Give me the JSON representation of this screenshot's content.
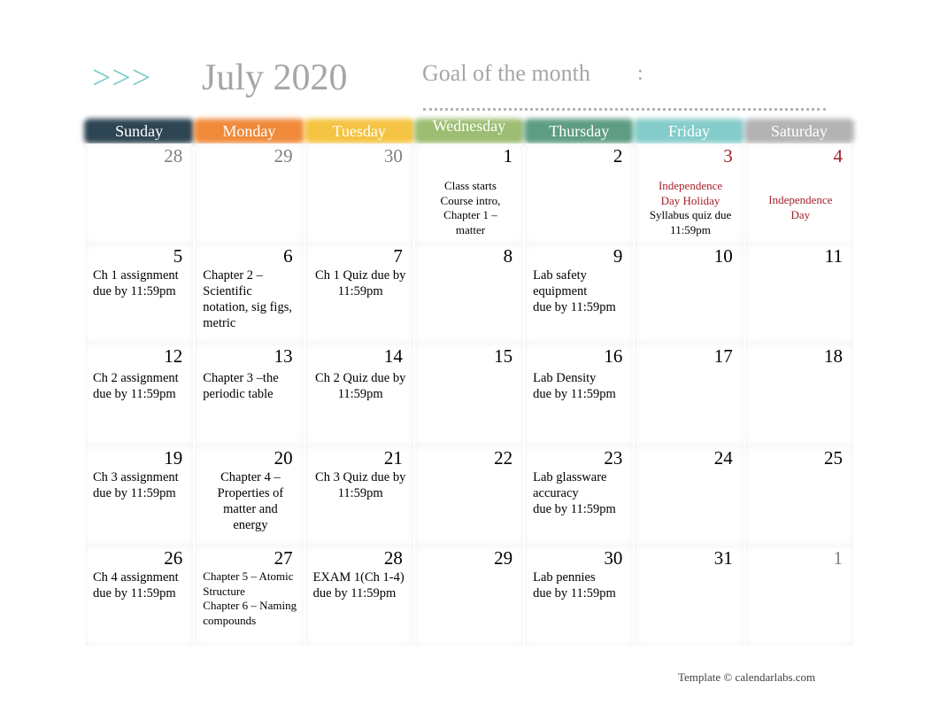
{
  "header": {
    "arrows": ">>>",
    "month_title": "July 2020",
    "goal_label": "Goal of the month",
    "goal_colon": ":",
    "goal_value": ""
  },
  "weekdays": [
    {
      "label": "Sunday",
      "color": "#2e4553"
    },
    {
      "label": "Monday",
      "color": "#f08a3a"
    },
    {
      "label": "Tuesday",
      "color": "#f5c342"
    },
    {
      "label": "Wednesday",
      "color": "#9cbd72"
    },
    {
      "label": "Thursday",
      "color": "#5e9d84"
    },
    {
      "label": "Friday",
      "color": "#84cccb"
    },
    {
      "label": "Saturday",
      "color": "#b3b3b3"
    }
  ],
  "colors": {
    "holiday_red": "#a31f2b",
    "title_gray": "#a6a6a6",
    "arrow_teal": "#7fcbc9"
  },
  "weeks": [
    [
      {
        "day": "28",
        "muted": true,
        "note": ""
      },
      {
        "day": "29",
        "muted": true,
        "note": ""
      },
      {
        "day": "30",
        "muted": true,
        "note": ""
      },
      {
        "day": "1",
        "note": "Class starts\nCourse intro,\nChapter 1 –\nmatter"
      },
      {
        "day": "2",
        "note": ""
      },
      {
        "day": "3",
        "holiday": true,
        "holiday_note": "Independence\nDay Holiday",
        "note": "Syllabus quiz due\n11:59pm"
      },
      {
        "day": "4",
        "holiday": true,
        "holiday_note": "Independence\nDay",
        "note": ""
      }
    ],
    [
      {
        "day": "5",
        "note": "Ch 1 assignment\ndue by 11:59pm"
      },
      {
        "day": "6",
        "note": "Chapter 2 –\nScientific\nnotation, sig figs,\nmetric"
      },
      {
        "day": "7",
        "note": "Ch 1 Quiz due by\n11:59pm"
      },
      {
        "day": "8",
        "note": ""
      },
      {
        "day": "9",
        "note": "Lab safety\nequipment\n  due by 11:59pm"
      },
      {
        "day": "10",
        "note": ""
      },
      {
        "day": "11",
        "note": ""
      }
    ],
    [
      {
        "day": "12",
        "note": "Ch 2 assignment\ndue by 11:59pm"
      },
      {
        "day": "13",
        "note": "Chapter 3 –the\nperiodic table"
      },
      {
        "day": "14",
        "note": "Ch 2 Quiz due by\n11:59pm"
      },
      {
        "day": "15",
        "note": ""
      },
      {
        "day": "16",
        "note": "Lab Density\n  due by 11:59pm"
      },
      {
        "day": "17",
        "note": ""
      },
      {
        "day": "18",
        "note": ""
      }
    ],
    [
      {
        "day": "19",
        "note": "Ch 3 assignment\ndue by 11:59pm"
      },
      {
        "day": "20",
        "note": "Chapter 4 –\nProperties of\nmatter and\nenergy"
      },
      {
        "day": "21",
        "note": "Ch 3 Quiz due by\n11:59pm"
      },
      {
        "day": "22",
        "note": ""
      },
      {
        "day": "23",
        "note": "Lab glassware\naccuracy\n  due by 11:59pm"
      },
      {
        "day": "24",
        "note": ""
      },
      {
        "day": "25",
        "note": ""
      }
    ],
    [
      {
        "day": "26",
        "note": "Ch 4 assignment\ndue by 11:59pm"
      },
      {
        "day": "27",
        "note": "Chapter 5 – Atomic\nStructure\nChapter 6 – Naming\ncompounds"
      },
      {
        "day": "28",
        "note": " EXAM 1(Ch 1-4)\ndue by 11:59pm"
      },
      {
        "day": "29",
        "note": ""
      },
      {
        "day": "30",
        "note": "Lab pennies\n  due by 11:59pm"
      },
      {
        "day": "31",
        "note": ""
      },
      {
        "day": "1",
        "muted": true,
        "note": ""
      }
    ]
  ],
  "footer": "Template © calendarlabs.com"
}
